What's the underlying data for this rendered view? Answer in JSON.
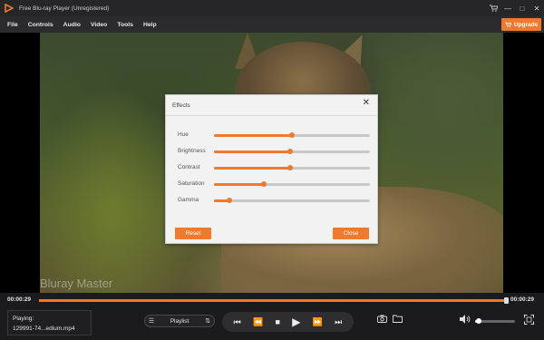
{
  "app": {
    "title": "Free Blu-ray Player (Unregistered)"
  },
  "window_controls": {
    "upgrade_icon": "cart-icon",
    "minimize": "—",
    "maximize": "□",
    "close": "✕"
  },
  "menu": {
    "items": [
      "File",
      "Controls",
      "Audio",
      "Video",
      "Tools",
      "Help"
    ],
    "upgrade_label": "Upgrade"
  },
  "video": {
    "watermark": "Bluray Master"
  },
  "effects_dialog": {
    "title": "Effects",
    "sliders": [
      {
        "label": "Hue",
        "value": 0.5
      },
      {
        "label": "Brightness",
        "value": 0.49
      },
      {
        "label": "Contrast",
        "value": 0.49
      },
      {
        "label": "Saturation",
        "value": 0.32
      },
      {
        "label": "Gamma",
        "value": 0.1
      }
    ],
    "reset_label": "Reset",
    "close_label": "Close"
  },
  "progress": {
    "current_time": "00:00:29",
    "total_time": "00:00:29",
    "progress": 1.0
  },
  "now_playing": {
    "label": "Playing:",
    "file": "129991-74...edium.mp4"
  },
  "playlist": {
    "label": "Playlist"
  },
  "volume": {
    "level": 0.1
  },
  "colors": {
    "accent": "#ee7a2f",
    "dialog_bg": "#f2f2f2",
    "chrome": "#1b1b1d"
  }
}
